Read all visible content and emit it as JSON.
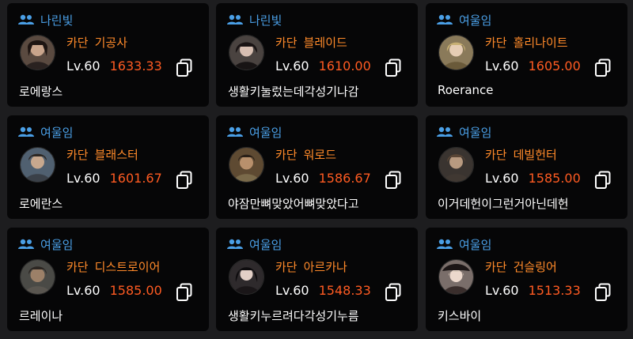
{
  "cards": [
    {
      "guild": "나린빛",
      "server": "카단",
      "job": "기공사",
      "level": "Lv.60",
      "item_level": "1633.33",
      "name": "로에랑스",
      "avatar": "character-portrait-icon"
    },
    {
      "guild": "나린빛",
      "server": "카단",
      "job": "블레이드",
      "level": "Lv.60",
      "item_level": "1610.00",
      "name": "생활키눌렀는데각성기나감",
      "avatar": "character-portrait-icon"
    },
    {
      "guild": "여울임",
      "server": "카단",
      "job": "홀리나이트",
      "level": "Lv.60",
      "item_level": "1605.00",
      "name": "Roerance",
      "avatar": "character-portrait-icon"
    },
    {
      "guild": "여울임",
      "server": "카단",
      "job": "블래스터",
      "level": "Lv.60",
      "item_level": "1601.67",
      "name": "로에란스",
      "avatar": "character-portrait-icon"
    },
    {
      "guild": "여울임",
      "server": "카단",
      "job": "워로드",
      "level": "Lv.60",
      "item_level": "1586.67",
      "name": "야잠만뼈맞았어뼈맞았다고",
      "avatar": "character-portrait-icon"
    },
    {
      "guild": "여울임",
      "server": "카단",
      "job": "데빌헌터",
      "level": "Lv.60",
      "item_level": "1585.00",
      "name": "이거데헌이그런거아닌데헌",
      "avatar": "character-portrait-icon"
    },
    {
      "guild": "여울임",
      "server": "카단",
      "job": "디스트로이어",
      "level": "Lv.60",
      "item_level": "1585.00",
      "name": "르레이나",
      "avatar": "character-portrait-icon"
    },
    {
      "guild": "여울임",
      "server": "카단",
      "job": "아르카나",
      "level": "Lv.60",
      "item_level": "1548.33",
      "name": "생활키누르려다각성기누름",
      "avatar": "character-portrait-icon"
    },
    {
      "guild": "여울임",
      "server": "카단",
      "job": "건슬링어",
      "level": "Lv.60",
      "item_level": "1513.33",
      "name": "키스바이",
      "avatar": "character-portrait-icon"
    }
  ],
  "icons": {
    "guild": "people-icon",
    "copy": "copy-icon"
  },
  "colors": {
    "guild": "#4a9fe6",
    "job": "#ff8a2a",
    "item_level": "#ff5b22",
    "card_bg": "#060607",
    "page_bg": "#1d1d1f"
  }
}
